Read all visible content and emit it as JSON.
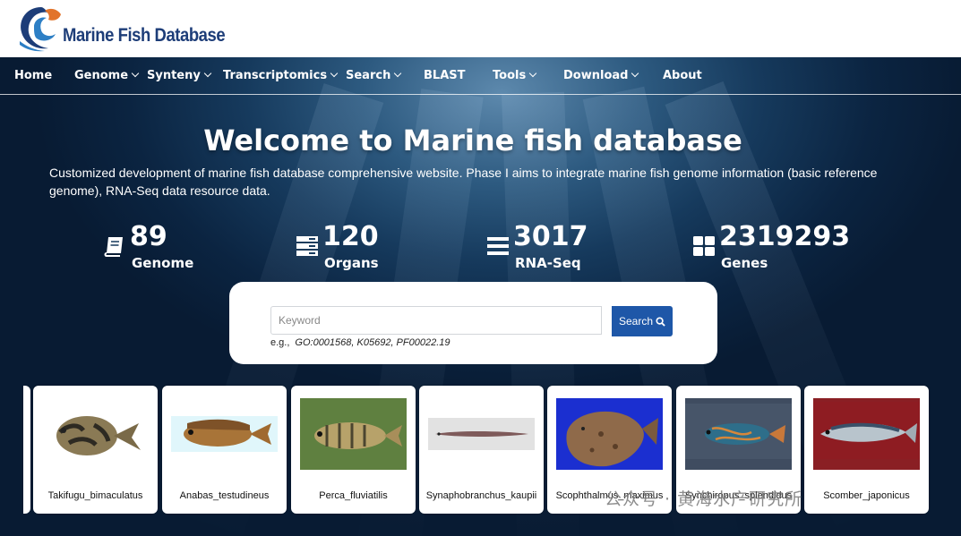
{
  "brand": {
    "name": "Marine Fish Database"
  },
  "nav": {
    "items": [
      {
        "label": "Home",
        "dropdown": false
      },
      {
        "label": "Genome",
        "dropdown": true
      },
      {
        "label": "Synteny",
        "dropdown": true
      },
      {
        "label": "Transcriptomics",
        "dropdown": true
      },
      {
        "label": "Search",
        "dropdown": true
      },
      {
        "label": "BLAST",
        "dropdown": false
      },
      {
        "label": "Tools",
        "dropdown": true
      },
      {
        "label": "Download",
        "dropdown": true
      },
      {
        "label": "About",
        "dropdown": false
      }
    ]
  },
  "hero": {
    "title": "Welcome to Marine fish database",
    "description": "Customized development of marine fish database comprehensive website. Phase I aims to integrate marine fish genome information (basic reference genome), RNA-Seq data resource data."
  },
  "stats": [
    {
      "value": "89",
      "label": "Genome",
      "icon": "book-icon"
    },
    {
      "value": "120",
      "label": "Organs",
      "icon": "server-icon"
    },
    {
      "value": "3017",
      "label": "RNA-Seq",
      "icon": "list-icon"
    },
    {
      "value": "2319293",
      "label": "Genes",
      "icon": "grid-icon"
    }
  ],
  "search": {
    "placeholder": "Keyword",
    "button_label": "Search",
    "example_prefix": "e.g.,",
    "example_values": "GO:0001568, K05692, PF00022.19"
  },
  "species": [
    {
      "name": "Takifugu_bimaculatus"
    },
    {
      "name": "Anabas_testudineus"
    },
    {
      "name": "Perca_fluviatilis"
    },
    {
      "name": "Synaphobranchus_kaupii"
    },
    {
      "name": "Scophthalmus_maximus"
    },
    {
      "name": "Synchiropus_splendidus"
    },
    {
      "name": "Scomber_japonicus"
    }
  ],
  "watermark": "公众号 · 黄海水产研究所",
  "colors": {
    "logo_text": "#1d3d78",
    "search_button": "#1e57a8",
    "logo_orange": "#e2742b"
  }
}
